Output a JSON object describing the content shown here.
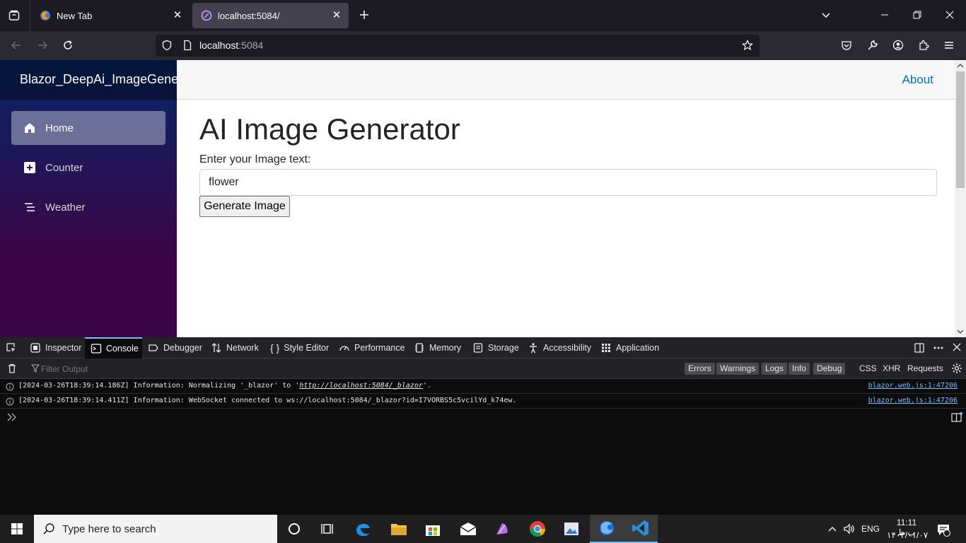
{
  "browser": {
    "tabs": [
      {
        "title": "New Tab"
      },
      {
        "title": "localhost:5084/"
      }
    ],
    "url_host": "localhost",
    "url_port": ":5084"
  },
  "app": {
    "brand": "Blazor_DeepAi_ImageGenerator",
    "nav": [
      {
        "label": "Home",
        "icon": "home-icon"
      },
      {
        "label": "Counter",
        "icon": "plus-square-icon"
      },
      {
        "label": "Weather",
        "icon": "list-icon"
      }
    ],
    "about": "About",
    "heading": "AI Image Generator",
    "prompt_label": "Enter your Image text:",
    "prompt_value": "flower",
    "generate_button": "Generate Image"
  },
  "devtools": {
    "tabs": [
      {
        "label": "Inspector",
        "icon": "inspector-icon"
      },
      {
        "label": "Console",
        "icon": "console-icon"
      },
      {
        "label": "Debugger",
        "icon": "debugger-icon"
      },
      {
        "label": "Network",
        "icon": "network-icon"
      },
      {
        "label": "Style Editor",
        "icon": "style-editor-icon"
      },
      {
        "label": "Performance",
        "icon": "performance-icon"
      },
      {
        "label": "Memory",
        "icon": "memory-icon"
      },
      {
        "label": "Storage",
        "icon": "storage-icon"
      },
      {
        "label": "Accessibility",
        "icon": "accessibility-icon"
      },
      {
        "label": "Application",
        "icon": "application-icon"
      }
    ],
    "filter_placeholder": "Filter Output",
    "levels": [
      "Errors",
      "Warnings",
      "Logs",
      "Info",
      "Debug"
    ],
    "extra_filters": [
      "CSS",
      "XHR",
      "Requests"
    ],
    "logs": [
      {
        "prefix": "[2024-03-26T18:39:14.186Z] Information: Normalizing '_blazor' to '",
        "link": "http://localhost:5084/_blazor",
        "suffix": "'.",
        "source": "blazor.web.js:1:47206"
      },
      {
        "prefix": "[2024-03-26T18:39:14.411Z] Information: WebSocket connected to ws://localhost:5084/_blazor?id=I7VORBS5c5vcilYd_k74ew.",
        "link": "",
        "suffix": "",
        "source": "blazor.web.js:1:47206"
      }
    ]
  },
  "taskbar": {
    "search_placeholder": "Type here to search",
    "lang": "ENG",
    "time": "11:11 ب.ظ",
    "date": "۱۴۰۳/۰۱/۰۷"
  },
  "colors": {
    "sidebar_top": "#052767",
    "sidebar_bottom": "#3a0647",
    "link_blue": "#0071c1",
    "devtools_accent": "#75bfff"
  }
}
